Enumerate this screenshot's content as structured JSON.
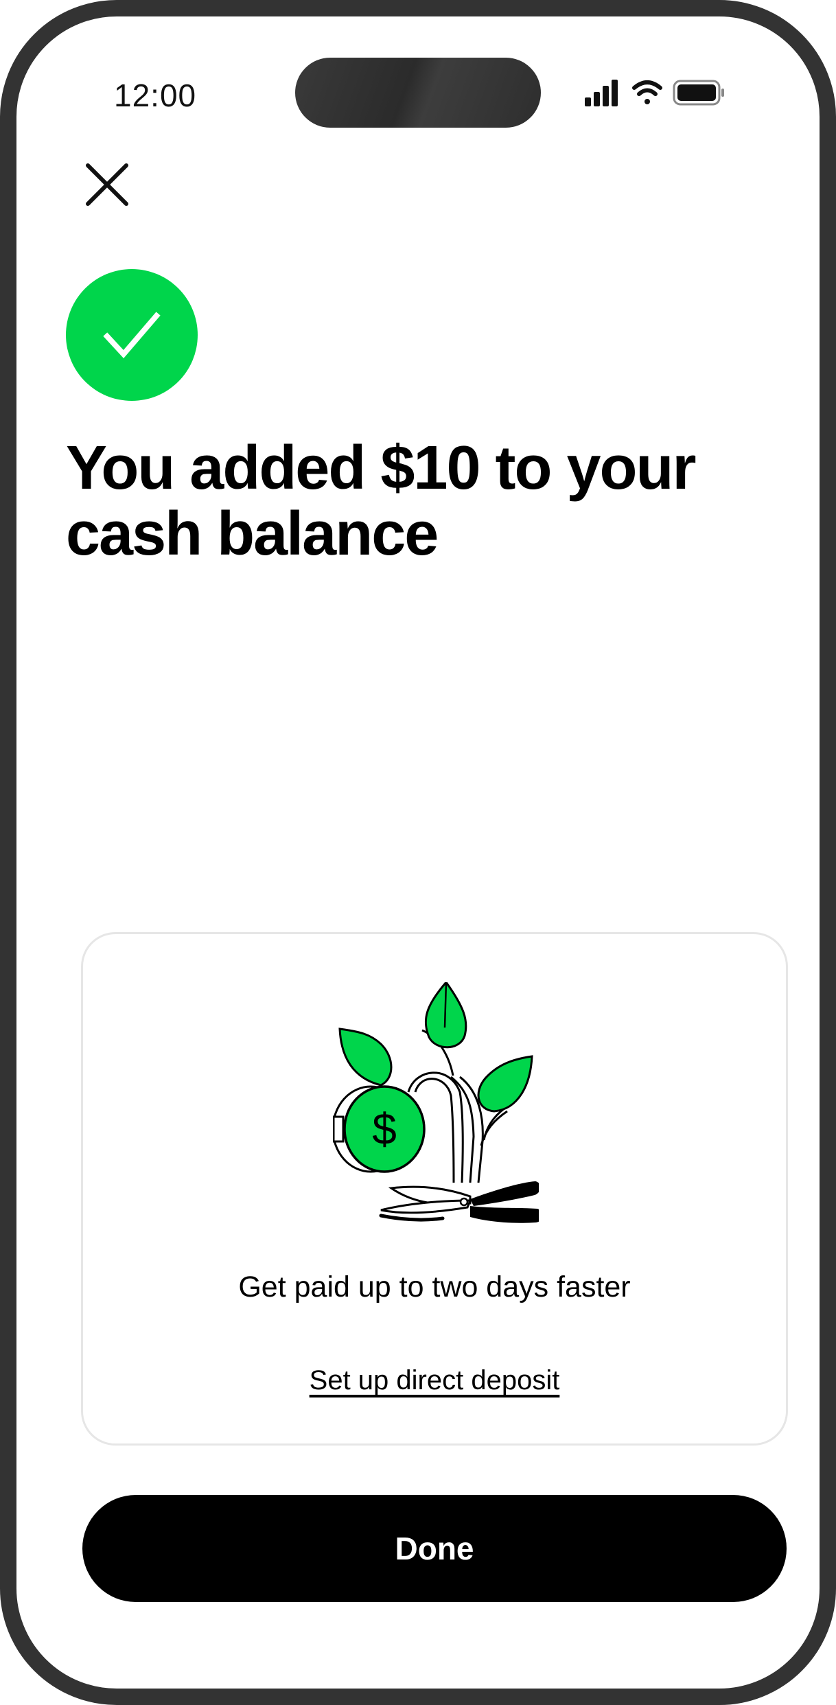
{
  "status_bar": {
    "time": "12:00"
  },
  "header": {
    "close_icon": "close-icon"
  },
  "confirmation": {
    "status_icon": "checkmark-icon",
    "headline": "You added $10 to your cash balance"
  },
  "promo": {
    "illustration": "money-plant-illustration",
    "text": "Get paid up to two days faster",
    "link_label": "Set up direct deposit"
  },
  "footer": {
    "done_label": "Done"
  },
  "colors": {
    "accent_green": "#00d54b",
    "frame": "#333333",
    "button_bg": "#000000",
    "button_text": "#ffffff",
    "card_border": "#e6e6e6"
  }
}
